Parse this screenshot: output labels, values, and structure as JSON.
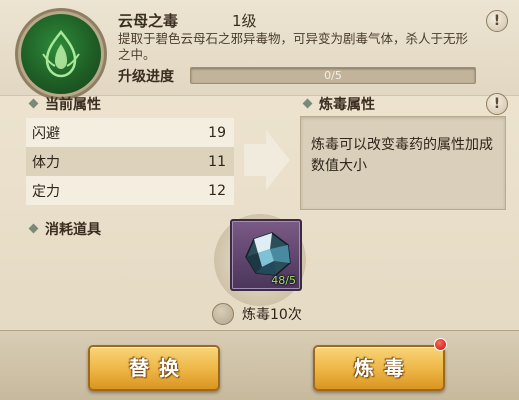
{
  "header": {
    "skill_name": "云母之毒",
    "level": "1级",
    "description": "提取于碧色云母石之邪异毒物，可异变为剧毒气体，杀人于无形之中。",
    "progress_label": "升级进度",
    "progress_text": "0/5",
    "progress_fraction": 0,
    "info_glyph": "!"
  },
  "current_attrs": {
    "title": "当前属性",
    "rows": [
      {
        "name": "闪避",
        "value": "19"
      },
      {
        "name": "体力",
        "value": "11"
      },
      {
        "name": "定力",
        "value": "12"
      }
    ]
  },
  "refine_attrs": {
    "title": "炼毒属性",
    "info_glyph": "!",
    "text": "炼毒可以改变毒药的属性加成数值大小"
  },
  "consumables": {
    "title": "消耗道具",
    "item_count": "48/5",
    "item_icon": "crystal-ore-icon"
  },
  "refine_option": {
    "label": "炼毒10次",
    "checked": false
  },
  "buttons": {
    "swap": "替换",
    "refine": "炼毒"
  },
  "colors": {
    "button_gold": "#efb848",
    "progress_fill": "#7cae3d",
    "notification_red": "#c2140d",
    "item_slot_purple": "#6a4a78"
  }
}
